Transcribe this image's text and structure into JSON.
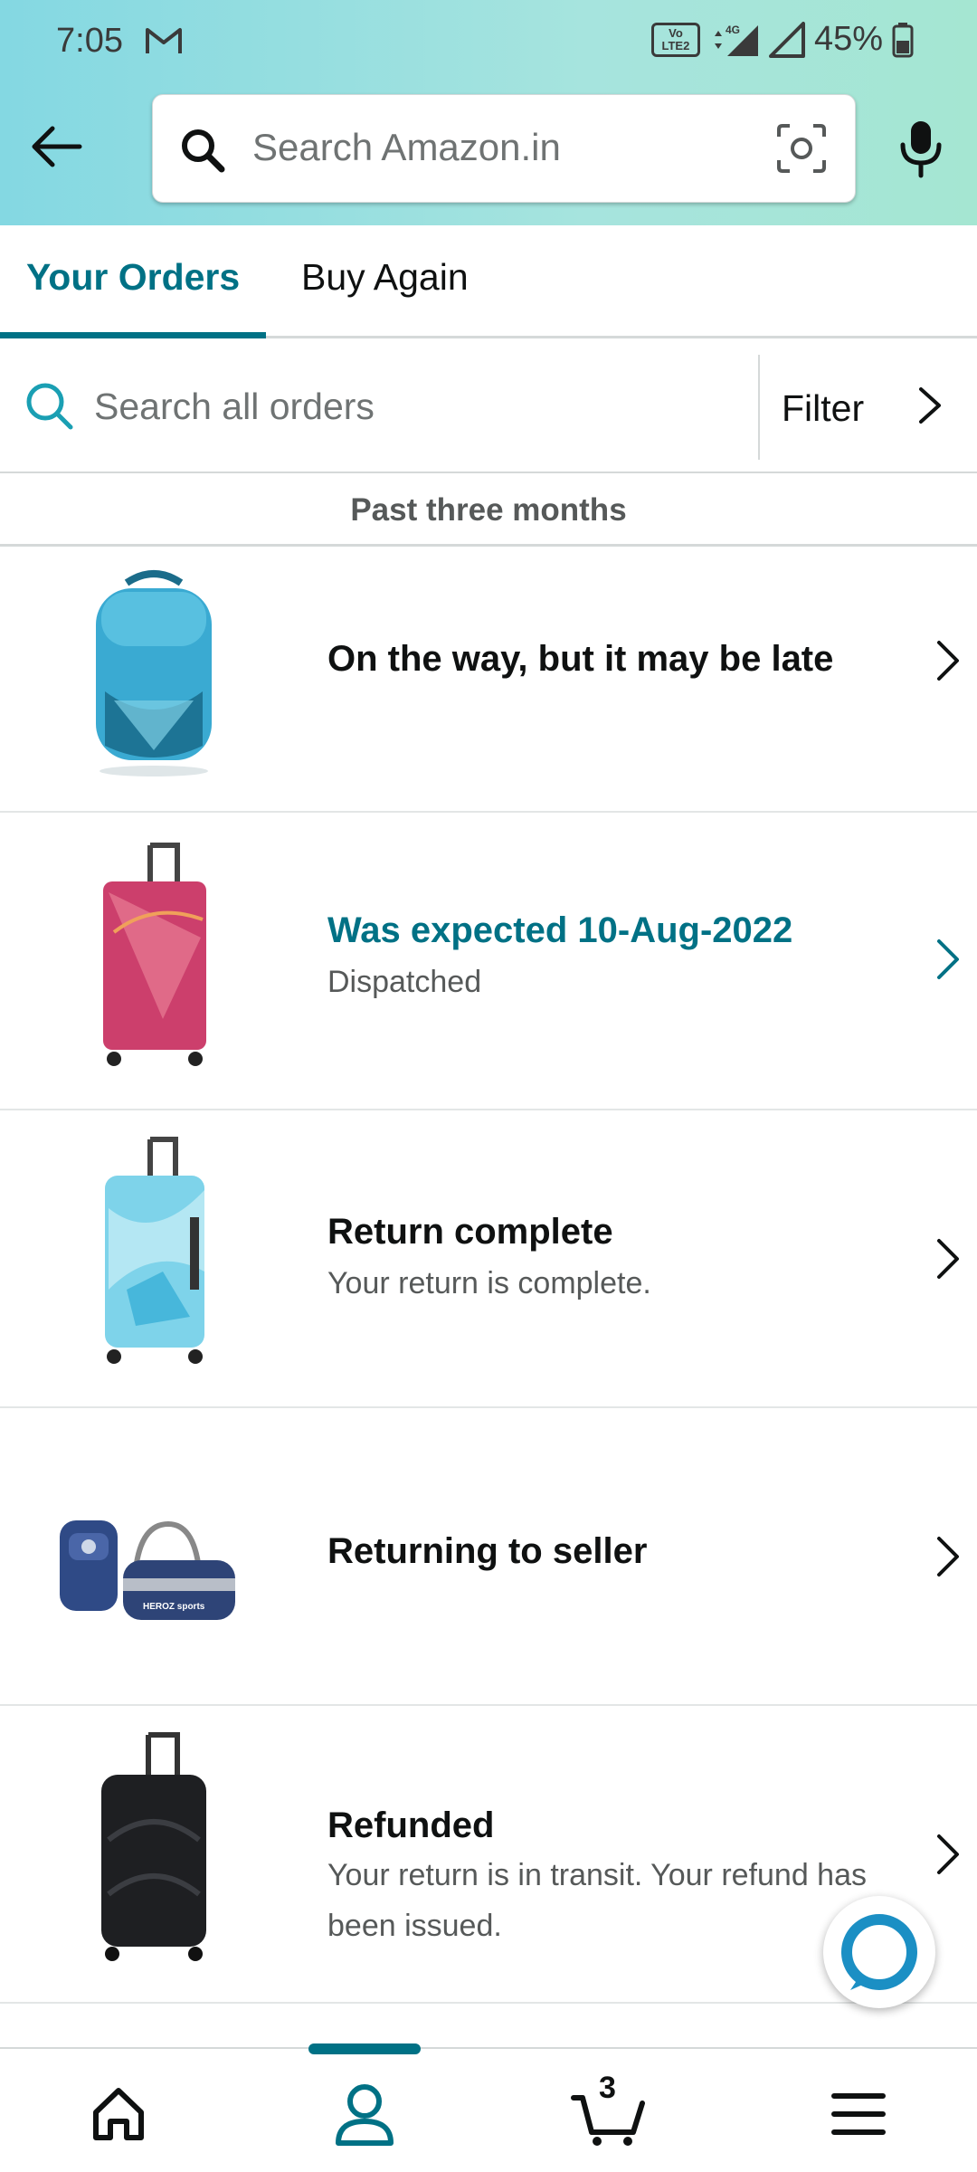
{
  "status_bar": {
    "time": "7:05",
    "network": "4G",
    "volte": "Vo LTE2",
    "battery": "45%"
  },
  "header": {
    "search_placeholder": "Search Amazon.in",
    "accent": "#007185"
  },
  "tabs": [
    {
      "label": "Your Orders",
      "active": true
    },
    {
      "label": "Buy Again",
      "active": false
    }
  ],
  "order_search": {
    "placeholder": "Search all orders",
    "filter_label": "Filter"
  },
  "period_label": "Past three months",
  "orders": [
    {
      "title": "On the way, but it may be late",
      "subtitle": "",
      "image": "teal-backpack",
      "title_color": "#0f1111"
    },
    {
      "title": "Was expected 10-Aug-2022",
      "subtitle": "Dispatched",
      "image": "pink-suitcase",
      "title_color": "#007185"
    },
    {
      "title": "Return complete",
      "subtitle": "Your return is complete.",
      "image": "sky-blue-suitcase",
      "title_color": "#0f1111"
    },
    {
      "title": "Returning to seller",
      "subtitle": "",
      "image": "backpack-and-duffel-bag",
      "title_color": "#0f1111"
    },
    {
      "title": "Refunded",
      "subtitle": "Your return is in transit. Your refund has been issued.",
      "image": "black-suitcase",
      "title_color": "#0f1111"
    }
  ],
  "bottom_nav": {
    "items": [
      "home-icon",
      "account-icon",
      "cart-icon",
      "menu-icon"
    ],
    "active": "account-icon",
    "cart_count": "3"
  }
}
